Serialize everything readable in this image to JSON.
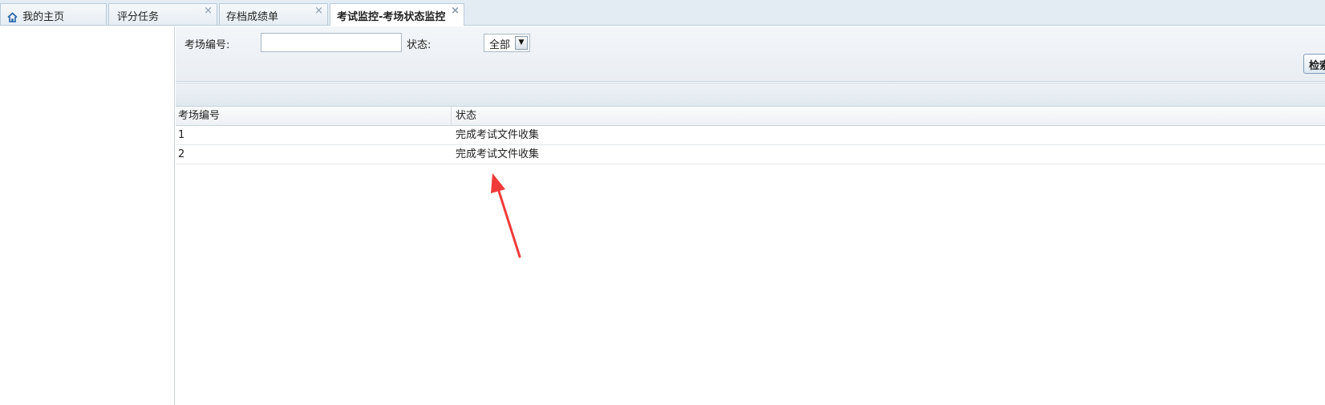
{
  "tabs": [
    {
      "label": "我的主页",
      "icon": "home-icon",
      "closable": false,
      "active": false
    },
    {
      "label": "评分任务",
      "closable": true,
      "active": false
    },
    {
      "label": "存档成绩单",
      "closable": true,
      "active": false
    },
    {
      "label": "考试监控-考场状态监控",
      "closable": true,
      "active": true
    }
  ],
  "tab_close_glyph": "×",
  "search": {
    "room_label": "考场编号:",
    "room_value": "",
    "status_label": "状态:",
    "status_selected": "全部",
    "search_button": "检索"
  },
  "grid": {
    "columns": [
      "考场编号",
      "状态"
    ],
    "rows": [
      [
        "1",
        "完成考试文件收集"
      ],
      [
        "2",
        "完成考试文件收集"
      ]
    ]
  },
  "colors": {
    "annotation_arrow": "#f03a3a",
    "tabbar_bg": "#e3ecf3"
  }
}
